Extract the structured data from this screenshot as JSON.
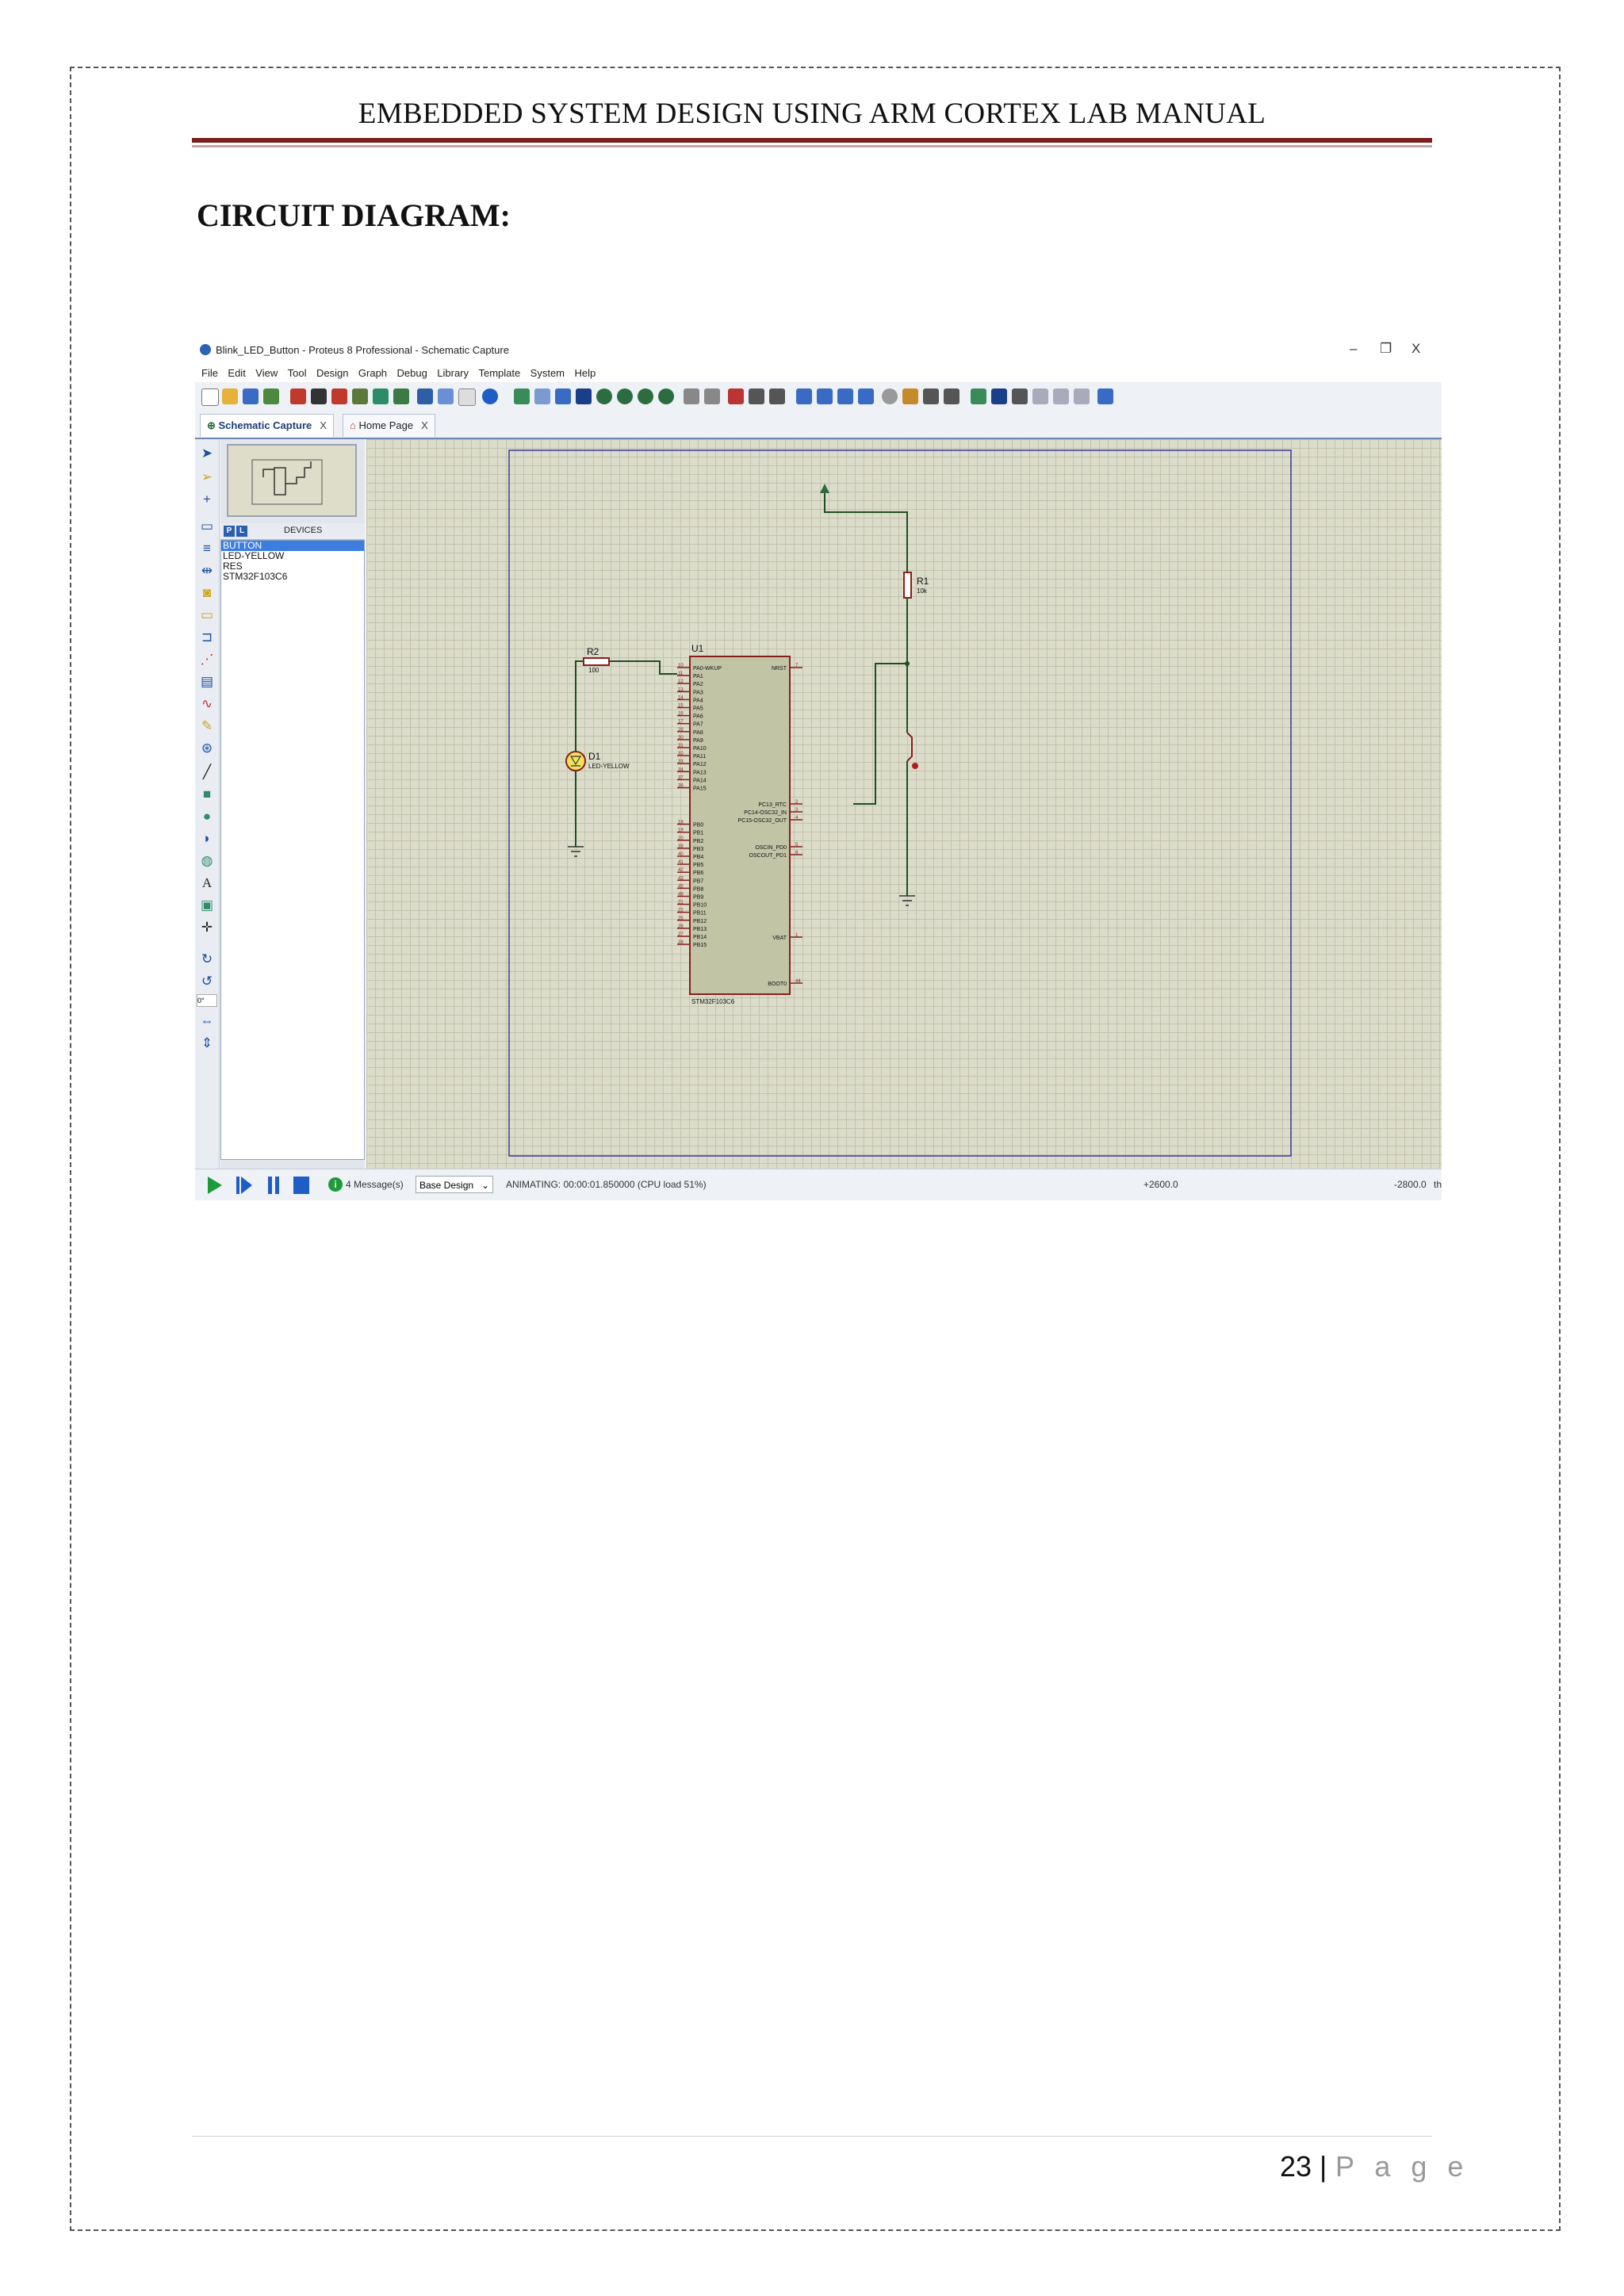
{
  "header": {
    "title": "EMBEDDED SYSTEM DESIGN USING ARM CORTEX LAB MANUAL"
  },
  "section": {
    "title": "CIRCUIT DIAGRAM:"
  },
  "app": {
    "window_title": "Blink_LED_Button - Proteus 8 Professional - Schematic Capture",
    "controls": {
      "minimize": "–",
      "restore": "❐",
      "close": "X"
    },
    "menu": [
      "File",
      "Edit",
      "View",
      "Tool",
      "Design",
      "Graph",
      "Debug",
      "Library",
      "Template",
      "System",
      "Help"
    ],
    "tabs": [
      {
        "label": "Schematic Capture",
        "close": "X"
      },
      {
        "label": "Home Page",
        "close": "X"
      }
    ],
    "devices_panel": {
      "p_button": "P",
      "l_button": "L",
      "header": "DEVICES",
      "items": [
        "BUTTON",
        "LED-YELLOW",
        "RES",
        "STM32F103C6"
      ],
      "selected": "BUTTON"
    },
    "rotation_value": "0°",
    "status": {
      "messages": "4 Message(s)",
      "design": "Base Design",
      "animating": "ANIMATING: 00:00:01.850000 (CPU load 51%)",
      "coord_x": "+2600.0",
      "coord_y": "-2800.0",
      "unit": "th"
    },
    "schematic": {
      "r1": {
        "ref": "R1",
        "value": "10k"
      },
      "r2": {
        "ref": "R2",
        "value": "100"
      },
      "d1": {
        "ref": "D1",
        "value": "LED-YELLOW"
      },
      "u1": {
        "ref": "U1",
        "part": "STM32F103C6",
        "left_pins": [
          {
            "num": "10",
            "name": "PA0-WKUP"
          },
          {
            "num": "11",
            "name": "PA1"
          },
          {
            "num": "12",
            "name": "PA2"
          },
          {
            "num": "13",
            "name": "PA3"
          },
          {
            "num": "14",
            "name": "PA4"
          },
          {
            "num": "15",
            "name": "PA5"
          },
          {
            "num": "16",
            "name": "PA6"
          },
          {
            "num": "17",
            "name": "PA7"
          },
          {
            "num": "29",
            "name": "PA8"
          },
          {
            "num": "30",
            "name": "PA9"
          },
          {
            "num": "31",
            "name": "PA10"
          },
          {
            "num": "32",
            "name": "PA11"
          },
          {
            "num": "33",
            "name": "PA12"
          },
          {
            "num": "34",
            "name": "PA13"
          },
          {
            "num": "37",
            "name": "PA14"
          },
          {
            "num": "38",
            "name": "PA15"
          },
          {
            "num": "18",
            "name": "PB0"
          },
          {
            "num": "19",
            "name": "PB1"
          },
          {
            "num": "20",
            "name": "PB2"
          },
          {
            "num": "39",
            "name": "PB3"
          },
          {
            "num": "40",
            "name": "PB4"
          },
          {
            "num": "41",
            "name": "PB5"
          },
          {
            "num": "42",
            "name": "PB6"
          },
          {
            "num": "43",
            "name": "PB7"
          },
          {
            "num": "45",
            "name": "PB8"
          },
          {
            "num": "46",
            "name": "PB9"
          },
          {
            "num": "21",
            "name": "PB10"
          },
          {
            "num": "22",
            "name": "PB11"
          },
          {
            "num": "25",
            "name": "PB12"
          },
          {
            "num": "26",
            "name": "PB13"
          },
          {
            "num": "27",
            "name": "PB14"
          },
          {
            "num": "28",
            "name": "PB15"
          }
        ],
        "right_pins": [
          {
            "num": "7",
            "name": "NRST"
          },
          {
            "num": "2",
            "name": "PC13_RTC"
          },
          {
            "num": "3",
            "name": "PC14-OSC32_IN"
          },
          {
            "num": "4",
            "name": "PC15-OSC32_OUT"
          },
          {
            "num": "5",
            "name": "OSCIN_PD0"
          },
          {
            "num": "6",
            "name": "OSCOUT_PD1"
          },
          {
            "num": "1",
            "name": "VBAT"
          },
          {
            "num": "44",
            "name": "BOOT0"
          }
        ]
      }
    }
  },
  "footer": {
    "page_number": "23",
    "separator": "|",
    "page_label": "P a g e"
  }
}
